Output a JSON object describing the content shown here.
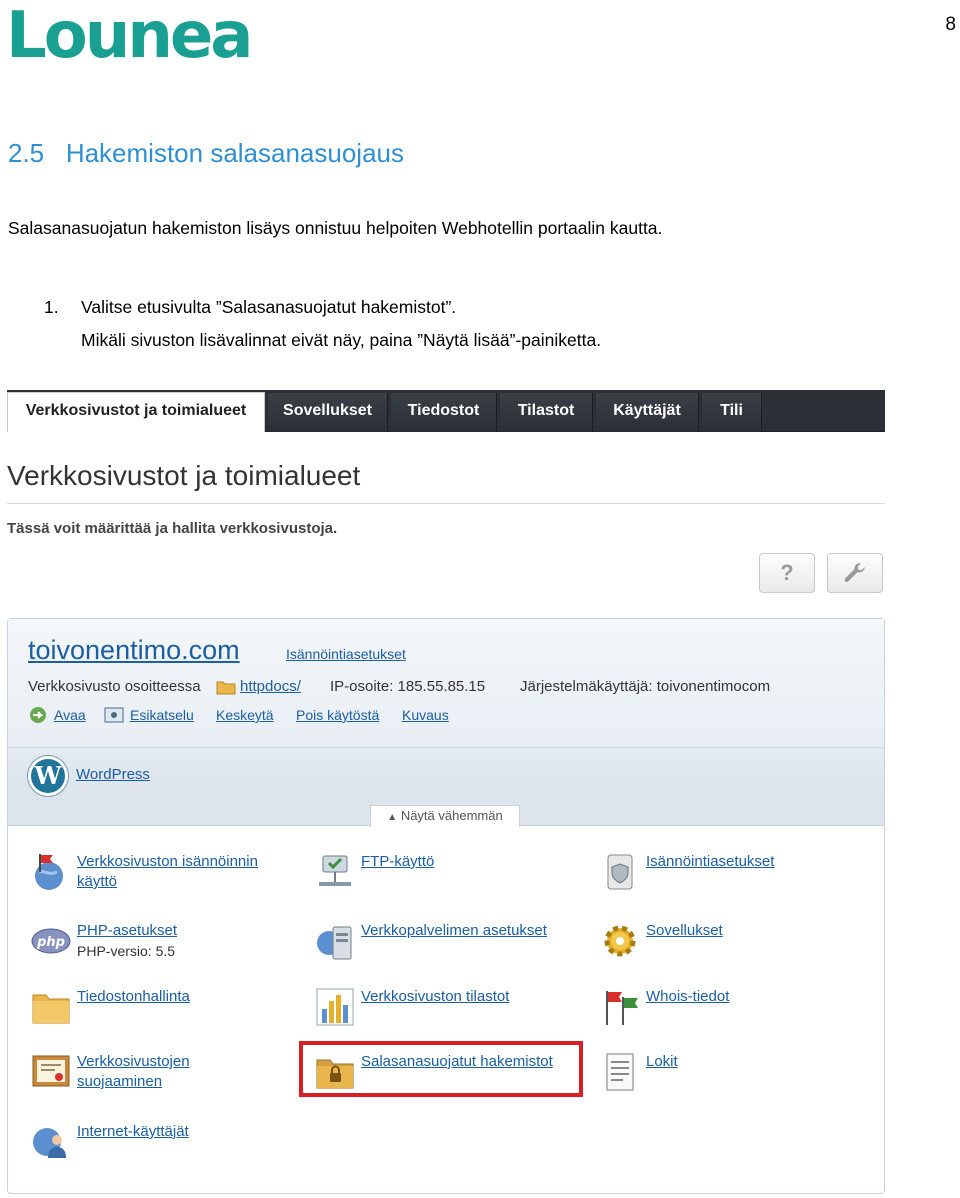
{
  "document": {
    "logo_text": "Lounea",
    "page_number": "8",
    "section_title": "2.5   Hakemiston salasanasuojaus",
    "intro": "Salasanasuojatun hakemiston lisäys onnistuu helpoiten Webhotellin portaalin kautta.",
    "step": {
      "number": "1.",
      "line1": "Valitse etusivulta ”Salasanasuojatut hakemistot”.",
      "line2": "Mikäli sivuston lisävalinnat eivät näy, paina ”Näytä lisää”-painiketta."
    }
  },
  "screenshot": {
    "tabs": [
      "Verkkosivustot ja toimialueet",
      "Sovellukset",
      "Tiedostot",
      "Tilastot",
      "Käyttäjät",
      "Tili"
    ],
    "page_title": "Verkkosivustot ja toimialueet",
    "page_subtitle": "Tässä voit määrittää ja hallita verkkosivustoja.",
    "toolbar": {
      "help_label": "?",
      "settings_icon": "wrench-icon"
    },
    "domain": {
      "name": "toivonentimo.com",
      "hosting_settings_link": "Isännöintiasetukset",
      "address_label": "Verkkosivusto osoitteessa",
      "address_link": "httpdocs/",
      "ip_label": "IP-osoite: 185.55.85.15",
      "system_user": "Järjestelmäkäyttäjä: toivonentimocom",
      "actions": [
        "Avaa",
        "Esikatselu",
        "Keskeytä",
        "Pois käytöstä",
        "Kuvaus"
      ],
      "wordpress_link": "WordPress",
      "show_less": "Näytä vähemmän"
    },
    "tools": [
      {
        "label1": "Verkkosivuston isännöinnin",
        "label2": "käyttö",
        "sub": "",
        "icon": "globe-flag-icon"
      },
      {
        "label1": "FTP-käyttö",
        "label2": "",
        "sub": "",
        "icon": "ftp-network-icon"
      },
      {
        "label1": "Isännöintiasetukset",
        "label2": "",
        "sub": "",
        "icon": "scroll-shield-icon"
      },
      {
        "label1": "PHP-asetukset",
        "label2": "",
        "sub": "PHP-versio: 5.5",
        "icon": "php-icon"
      },
      {
        "label1": "Verkkopalvelimen asetukset",
        "label2": "",
        "sub": "",
        "icon": "web-server-icon"
      },
      {
        "label1": "Sovellukset",
        "label2": "",
        "sub": "",
        "icon": "gear-icon"
      },
      {
        "label1": "Tiedostonhallinta",
        "label2": "",
        "sub": "",
        "icon": "folder-icon"
      },
      {
        "label1": "Verkkosivuston tilastot",
        "label2": "",
        "sub": "",
        "icon": "bar-chart-icon"
      },
      {
        "label1": "Whois-tiedot",
        "label2": "",
        "sub": "",
        "icon": "flags-icon"
      },
      {
        "label1": "Verkkosivustojen",
        "label2": "suojaaminen",
        "sub": "",
        "icon": "certificate-icon"
      },
      {
        "label1": "Salasanasuojatut hakemistot",
        "label2": "",
        "sub": "",
        "icon": "locked-folder-icon"
      },
      {
        "label1": "Lokit",
        "label2": "",
        "sub": "",
        "icon": "document-icon"
      },
      {
        "label1": "Internet-käyttäjät",
        "label2": "",
        "sub": "",
        "icon": "users-globe-icon"
      }
    ],
    "highlight_color": "#d81f26"
  }
}
